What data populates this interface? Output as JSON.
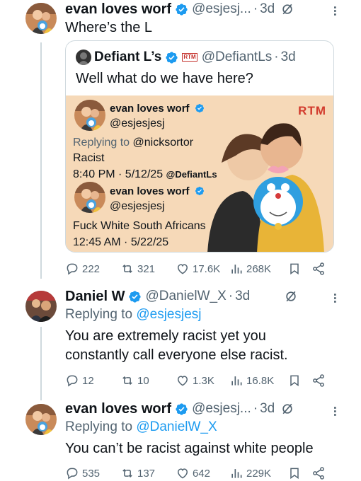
{
  "tweet1": {
    "name": "evan loves worf",
    "handle": "@esjesj...",
    "time": "3d",
    "text": "Where’s the L",
    "quote": {
      "name": "Defiant L’s",
      "badge": "RTM",
      "handle": "@DefiantLs",
      "time": "3d",
      "text": "Well what do we have here?",
      "media": {
        "logo": "RTM",
        "post1": {
          "name": "evan loves worf",
          "handle": "@esjesjesj",
          "replying_prefix": "Replying to ",
          "replying_to": "@nicksortor",
          "text": "Racist",
          "meta": "8:40 PM · 5/12/25",
          "watermark": "@DefiantLs"
        },
        "post2": {
          "name": "evan loves worf",
          "handle": "@esjesjesj",
          "text": "Fuck White South Africans",
          "meta": "12:45 AM · 5/22/25"
        }
      }
    },
    "stats": {
      "replies": "222",
      "reposts": "321",
      "likes": "17.6K",
      "views": "268K"
    }
  },
  "tweet2": {
    "name": "Daniel W",
    "handle": "@DanielW_X",
    "time": "3d",
    "replying_prefix": "Replying to ",
    "replying_to": "@esjesjesj",
    "text_line1": "You are extremely racist yet you",
    "text_line2": "constantly call everyone else racist.",
    "stats": {
      "replies": "12",
      "reposts": "10",
      "likes": "1.3K",
      "views": "16.8K"
    }
  },
  "tweet3": {
    "name": "evan loves worf",
    "handle": "@esjesj...",
    "time": "3d",
    "replying_prefix": "Replying to ",
    "replying_to": "@DanielW_X",
    "text": "You can’t be racist against white people",
    "stats": {
      "replies": "535",
      "reposts": "137",
      "likes": "642",
      "views": "229K"
    }
  },
  "colors": {
    "accent": "#1d9bf0",
    "muted": "#536471",
    "rtm_red": "#d23a2c",
    "media_bg": "#f6d9b8"
  },
  "icons": [
    "verified-badge-icon",
    "grok-icon",
    "more-icon",
    "reply-icon",
    "repost-icon",
    "like-icon",
    "views-icon",
    "bookmark-icon",
    "share-icon"
  ]
}
